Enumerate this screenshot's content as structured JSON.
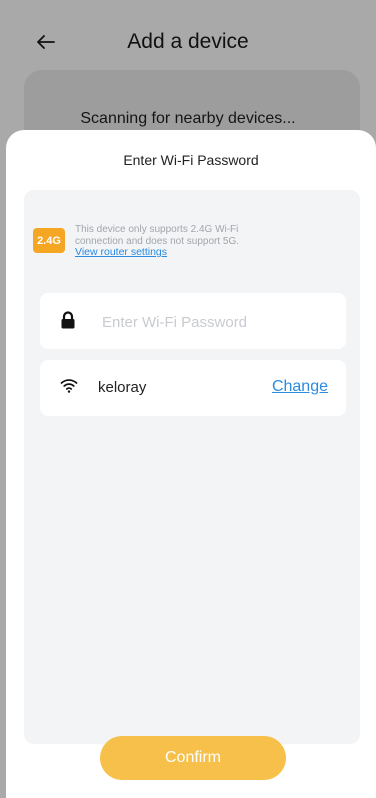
{
  "header": {
    "title": "Add a device",
    "back_icon": "arrow-left-icon"
  },
  "scan": {
    "status_text": "Scanning for nearby devices..."
  },
  "sheet": {
    "title": "Enter Wi-Fi Password",
    "badge_text": "2.4G",
    "notice_line1": "This device only supports 2.4G Wi-Fi",
    "notice_line2": "connection and does not support 5G.",
    "notice_link": "View router settings",
    "password": {
      "placeholder": "Enter Wi-Fi Password",
      "value": "",
      "icon": "lock-icon"
    },
    "wifi": {
      "icon": "wifi-icon",
      "ssid": "keloray",
      "change_label": "Change"
    },
    "confirm_label": "Confirm"
  },
  "colors": {
    "accent": "#f5a623",
    "button": "#f7c04a",
    "link": "#2a8be0",
    "overlay": "#a9a9a9"
  }
}
